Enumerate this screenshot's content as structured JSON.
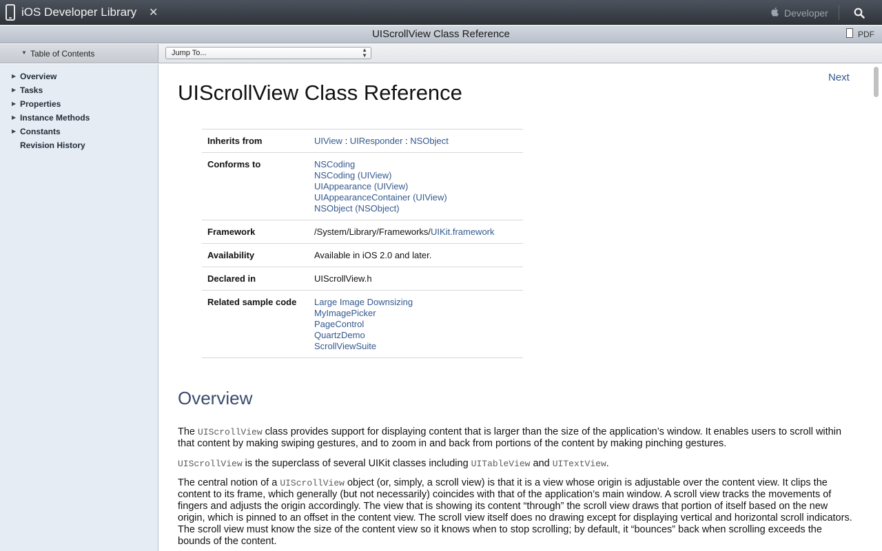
{
  "topbar": {
    "library_title": "iOS Developer Library",
    "developer_label": "Developer",
    "icons": [
      "phone-icon",
      "tools-icon",
      "apple-icon",
      "search-icon"
    ]
  },
  "titlebar": {
    "title": "UIScrollView Class Reference",
    "pdf_label": "PDF"
  },
  "toc": {
    "header_label": "Table of Contents",
    "jump_label": "Jump To...",
    "items": [
      {
        "label": "Overview",
        "expandable": true
      },
      {
        "label": "Tasks",
        "expandable": true
      },
      {
        "label": "Properties",
        "expandable": true
      },
      {
        "label": "Instance Methods",
        "expandable": true
      },
      {
        "label": "Constants",
        "expandable": true
      },
      {
        "label": "Revision History",
        "expandable": false
      }
    ]
  },
  "content": {
    "next_label": "Next",
    "page_title": "UIScrollView Class Reference",
    "info": {
      "inherits_key": "Inherits from",
      "inherits_links": [
        "UIView",
        "UIResponder",
        "NSObject"
      ],
      "inherits_sep": " : ",
      "conforms_key": "Conforms to",
      "conforms_links": [
        "NSCoding",
        "NSCoding (UIView)",
        "UIAppearance (UIView)",
        "UIAppearanceContainer (UIView)",
        "NSObject (NSObject)"
      ],
      "framework_key": "Framework",
      "framework_path": "/System/Library/Frameworks/",
      "framework_link": "UIKit.framework",
      "availability_key": "Availability",
      "availability_val": "Available in iOS 2.0 and later.",
      "declared_key": "Declared in",
      "declared_val": "UIScrollView.h",
      "sample_key": "Related sample code",
      "sample_links": [
        "Large Image Downsizing",
        "MyImagePicker",
        "PageControl",
        "QuartzDemo",
        "ScrollViewSuite"
      ]
    },
    "overview_heading": "Overview",
    "p1_code": "UIScrollView",
    "p1_a": "The ",
    "p1_b": " class provides support for displaying content that is larger than the size of the application’s window. It enables users to scroll within that content by making swiping gestures, and to zoom in and back from portions of the content by making pinching gestures.",
    "p2_code1": "UIScrollView",
    "p2_a": " is the superclass of several UIKit classes including ",
    "p2_code2": "UITableView",
    "p2_b": " and ",
    "p2_code3": "UITextView",
    "p2_c": ".",
    "p3_a": "The central notion of a ",
    "p3_code": "UIScrollView",
    "p3_b": " object (or, simply, a scroll view) is that it is a view whose origin is adjustable over the content view. It clips the content to its frame, which generally (but not necessarily) coincides with that of the application’s main window. A scroll view tracks the movements of fingers and adjusts the origin accordingly. The view that is showing its content “through” the scroll view draws that portion of itself based on the new origin, which is pinned to an offset in the content view. The scroll view itself does no drawing except for displaying vertical and horizontal scroll indicators. The scroll view must know the size of the content view so it knows when to stop scrolling; by default, it “bounces” back when scrolling exceeds the bounds of the content."
  },
  "colors": {
    "link": "#33588e",
    "heading": "#3b4a6b",
    "sidebar_bg": "#e6ecf3"
  }
}
